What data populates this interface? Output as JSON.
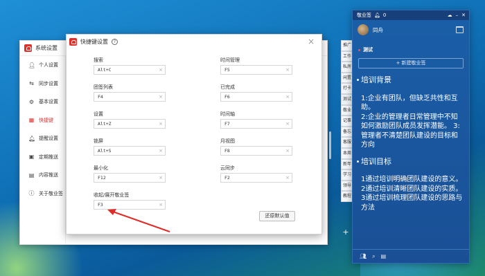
{
  "system_settings": {
    "title": "系统设置",
    "menu": [
      {
        "label": "个人设置",
        "icon": "user-icon",
        "active": false
      },
      {
        "label": "同步设置",
        "icon": "sync-icon",
        "active": false
      },
      {
        "label": "基本设置",
        "icon": "gear-icon",
        "active": false
      },
      {
        "label": "快捷键",
        "icon": "keyboard-icon",
        "active": true
      },
      {
        "label": "提醒设置",
        "icon": "bell-icon",
        "active": false
      },
      {
        "label": "定期推送",
        "icon": "push-icon",
        "active": false
      },
      {
        "label": "内容推送",
        "icon": "doc-icon",
        "active": false
      },
      {
        "label": "关于敬业签",
        "icon": "info-icon",
        "active": false
      }
    ]
  },
  "hotkey_dialog": {
    "title": "快捷键设置",
    "reset_label": "还原默认值",
    "left_fields": [
      {
        "label": "搜索",
        "value": "Alt+C"
      },
      {
        "label": "团签列表",
        "value": "F4"
      },
      {
        "label": "设置",
        "value": "Alt+Z"
      },
      {
        "label": "锁屏",
        "value": "Alt+S"
      },
      {
        "label": "最小化",
        "value": "F12"
      },
      {
        "label": "收起/展开敬业签",
        "value": "F3"
      }
    ],
    "right_fields": [
      {
        "label": "时间管理",
        "value": "F5"
      },
      {
        "label": "已完成",
        "value": "F6"
      },
      {
        "label": "时间轴",
        "value": "F7"
      },
      {
        "label": "月视图",
        "value": "F8"
      },
      {
        "label": "云同步",
        "value": "F2"
      }
    ]
  },
  "side_tabs": [
    "推广",
    "工作",
    "私房",
    "闲置",
    "打卡",
    "测试",
    "敬业",
    "记事",
    "备忘",
    "客服",
    "本周",
    "新年",
    "学习",
    "领导",
    "教程"
  ],
  "panel": {
    "app_name": "敬业签",
    "notif_count": "0",
    "user_name": "同舟",
    "section": "测试",
    "new_label": "+ 新建敬业签",
    "notes": [
      {
        "title": "培训背景",
        "body": "1:企业有团队，但缺乏共性和互助。\n2:企业的管理者日常管理中不知如何激励团队成员发挥潜能。 3:管理者不清楚团队建设的目标和方向"
      },
      {
        "title": "培训目标",
        "body": "1通过培训明确团队建设的意义。\n2通过培训清晰团队建设的实质。\n3通过培训梳理团队建设的思路与方法"
      }
    ]
  },
  "colors": {
    "accent": "#e0302c",
    "panel_bg": "#1a5fa8",
    "desktop": "#1f8fd6"
  }
}
